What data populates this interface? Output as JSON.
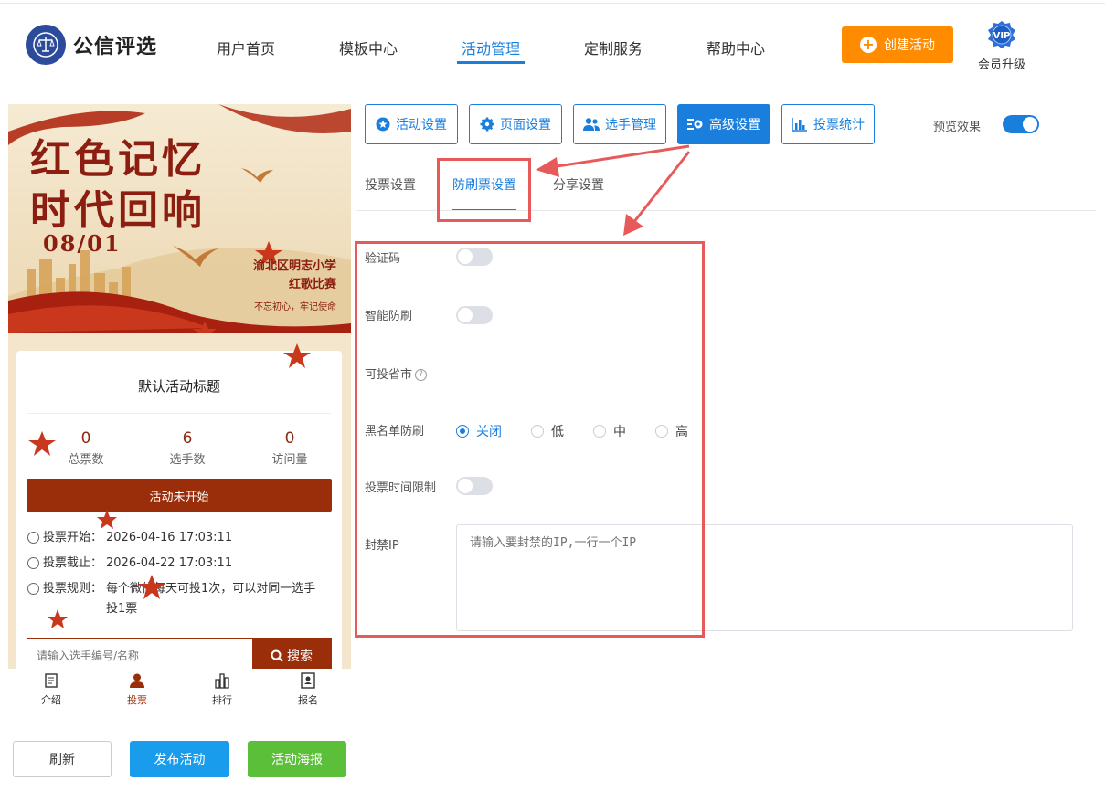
{
  "header": {
    "brand": "公信评选",
    "nav": [
      "用户首页",
      "模板中心",
      "活动管理",
      "定制服务",
      "帮助中心"
    ],
    "active_nav": "活动管理",
    "create_button": "创建活动",
    "vip_badge": "VIP",
    "vip_label": "会员升级"
  },
  "preview": {
    "banner_title_1": "红色记忆",
    "banner_title_2": "时代回响",
    "banner_date": "08/01",
    "banner_school_1": "渝北区明志小学",
    "banner_school_2": "红歌比赛",
    "banner_motto": "不忘初心，牢记使命",
    "card_title": "默认活动标题",
    "stats": [
      {
        "value": "0",
        "label": "总票数"
      },
      {
        "value": "6",
        "label": "选手数"
      },
      {
        "value": "0",
        "label": "访问量"
      }
    ],
    "status": "活动未开始",
    "vote_start_label": "投票开始：",
    "vote_start": "2026-04-16 17:03:11",
    "vote_end_label": "投票截止：",
    "vote_end": "2026-04-22 17:03:11",
    "rule_label": "投票规则：",
    "rule_text_1": "每个微信每天可投1次，可以对同一选手",
    "rule_text_2": "投1票",
    "search_placeholder": "请输入选手编号/名称",
    "search_button": "搜索",
    "bottom_nav": [
      "介绍",
      "投票",
      "排行",
      "报名"
    ]
  },
  "left_buttons": {
    "refresh": "刷新",
    "publish": "发布活动",
    "poster": "活动海报"
  },
  "settings": {
    "tabs": [
      "活动设置",
      "页面设置",
      "选手管理",
      "高级设置",
      "投票统计"
    ],
    "active_tab": "高级设置",
    "preview_label": "预览效果",
    "preview_enabled": true,
    "subtabs": [
      "投票设置",
      "防刷票设置",
      "分享设置"
    ],
    "active_subtab": "防刷票设置",
    "fields": {
      "captcha": {
        "label": "验证码",
        "enabled": false
      },
      "smart_antibrush": {
        "label": "智能防刷",
        "enabled": false
      },
      "regions": {
        "label": "可投省市"
      },
      "blacklist": {
        "label": "黑名单防刷",
        "options": [
          "关闭",
          "低",
          "中",
          "高"
        ],
        "selected": "关闭"
      },
      "time_limit": {
        "label": "投票时间限制",
        "enabled": false
      },
      "ban_ip": {
        "label": "封禁IP",
        "placeholder": "请输入要封禁的IP,一行一个IP"
      }
    }
  },
  "colors": {
    "primary": "#1a7fdc",
    "accent_orange": "#ff8c00",
    "theme_red": "#9a2d0a",
    "highlight_red": "#e85a5a",
    "poster_green": "#5cbf3a"
  }
}
